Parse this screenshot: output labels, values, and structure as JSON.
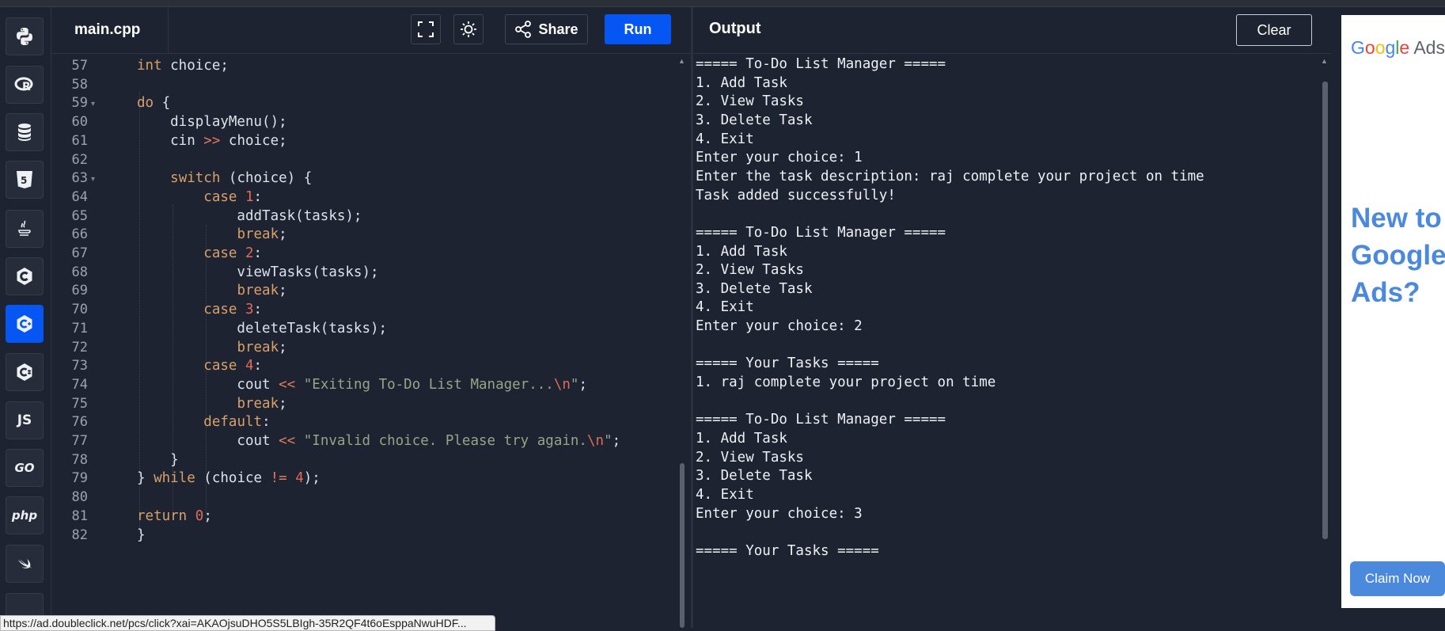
{
  "sidebar": {
    "languages": [
      {
        "name": "python",
        "icon": "python-icon"
      },
      {
        "name": "r",
        "icon": "r-icon"
      },
      {
        "name": "sql",
        "icon": "database-icon"
      },
      {
        "name": "html",
        "icon": "html5-icon"
      },
      {
        "name": "java",
        "icon": "java-icon"
      },
      {
        "name": "c",
        "icon": "c-icon"
      },
      {
        "name": "cpp",
        "icon": "cpp-icon",
        "active": true
      },
      {
        "name": "csharp",
        "icon": "csharp-icon"
      },
      {
        "name": "javascript",
        "icon": "js-icon",
        "label": "JS"
      },
      {
        "name": "go",
        "icon": "go-icon",
        "label": "GO"
      },
      {
        "name": "php",
        "icon": "php-icon",
        "label": "php"
      },
      {
        "name": "swift",
        "icon": "swift-icon"
      }
    ]
  },
  "editor": {
    "filename": "main.cpp",
    "fullscreen_icon": "fullscreen-icon",
    "theme_icon": "sun-icon",
    "share_label": "Share",
    "run_label": "Run",
    "lines": [
      {
        "num": "57",
        "text": "    int choice;"
      },
      {
        "num": "58",
        "text": ""
      },
      {
        "num": "59",
        "text": "    do {"
      },
      {
        "num": "60",
        "text": "        displayMenu();"
      },
      {
        "num": "61",
        "text": "        cin >> choice;"
      },
      {
        "num": "62",
        "text": ""
      },
      {
        "num": "63",
        "text": "        switch (choice) {"
      },
      {
        "num": "64",
        "text": "            case 1:"
      },
      {
        "num": "65",
        "text": "                addTask(tasks);"
      },
      {
        "num": "66",
        "text": "                break;"
      },
      {
        "num": "67",
        "text": "            case 2:"
      },
      {
        "num": "68",
        "text": "                viewTasks(tasks);"
      },
      {
        "num": "69",
        "text": "                break;"
      },
      {
        "num": "70",
        "text": "            case 3:"
      },
      {
        "num": "71",
        "text": "                deleteTask(tasks);"
      },
      {
        "num": "72",
        "text": "                break;"
      },
      {
        "num": "73",
        "text": "            case 4:"
      },
      {
        "num": "74",
        "text": "                cout << \"Exiting To-Do List Manager...\\n\";"
      },
      {
        "num": "75",
        "text": "                break;"
      },
      {
        "num": "76",
        "text": "            default:"
      },
      {
        "num": "77",
        "text": "                cout << \"Invalid choice. Please try again.\\n\";"
      },
      {
        "num": "78",
        "text": "        }"
      },
      {
        "num": "79",
        "text": "    } while (choice != 4);"
      },
      {
        "num": "80",
        "text": ""
      },
      {
        "num": "81",
        "text": "    return 0;"
      },
      {
        "num": "82",
        "text": "}"
      }
    ]
  },
  "output": {
    "title": "Output",
    "clear_label": "Clear",
    "lines": [
      "===== To-Do List Manager =====",
      "1. Add Task",
      "2. View Tasks",
      "3. Delete Task",
      "4. Exit",
      "Enter your choice: 1",
      "Enter the task description: raj complete your project on time",
      "Task added successfully!",
      "",
      "===== To-Do List Manager =====",
      "1. Add Task",
      "2. View Tasks",
      "3. Delete Task",
      "4. Exit",
      "Enter your choice: 2",
      "",
      "===== Your Tasks =====",
      "1. raj complete your project on time",
      "",
      "===== To-Do List Manager =====",
      "1. Add Task",
      "2. View Tasks",
      "3. Delete Task",
      "4. Exit",
      "Enter your choice: 3",
      "",
      "===== Your Tasks ====="
    ]
  },
  "ad": {
    "brand": "Google Ads",
    "headline": "New to Google Ads?",
    "cta": "Claim Now"
  },
  "status_url": "https://ad.doubleclick.net/pcs/click?xai=AKAOjsuDHO5S5LBIgh-35R2QF4t6oEsppaNwuHDF...",
  "colors": {
    "accent": "#0556f3",
    "background": "#1d2330",
    "keyword": "#d9a06b",
    "number": "#e06b57",
    "string": "#95a586",
    "ad_blue": "#4a89dc"
  }
}
